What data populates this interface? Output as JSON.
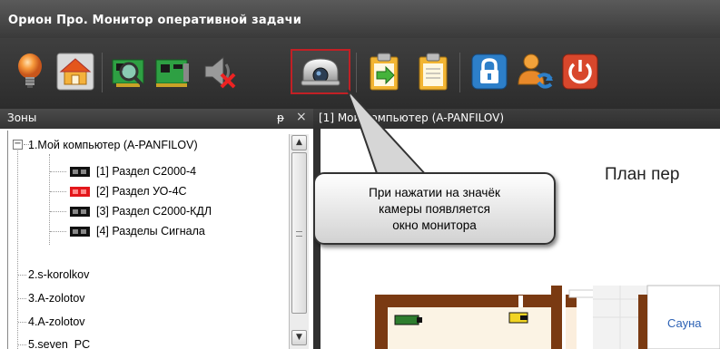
{
  "window": {
    "title": "Орион Про. Монитор оперативной задачи"
  },
  "toolbar": {
    "buttons": [
      {
        "name": "bulb-icon"
      },
      {
        "name": "home-icon"
      },
      {
        "name": "search-board-icon"
      },
      {
        "name": "board-icon"
      },
      {
        "name": "speaker-muted-icon"
      },
      {
        "name": "camera-icon",
        "selected": true
      },
      {
        "name": "clipboard-export-icon"
      },
      {
        "name": "clipboard-icon"
      },
      {
        "name": "lock-icon"
      },
      {
        "name": "user-switch-icon"
      },
      {
        "name": "power-icon"
      }
    ]
  },
  "zones_panel": {
    "title": "Зоны",
    "pin": "ᵽ",
    "close": "×",
    "expander": "−",
    "tree": [
      {
        "label": "1.Мой компьютер (A-PANFILOV)",
        "level": 0
      },
      {
        "label": "[1] Раздел С2000-4",
        "level": 1,
        "icon_color": "#111111"
      },
      {
        "label": "[2] Раздел УО-4С",
        "level": 1,
        "icon_color": "#e3171b"
      },
      {
        "label": "[3] Раздел С2000-КДЛ",
        "level": 1,
        "icon_color": "#111111"
      },
      {
        "label": "[4] Разделы Сигнала",
        "level": 1,
        "icon_color": "#111111"
      },
      {
        "label": "2.s-korolkov",
        "level": 0
      },
      {
        "label": "3.A-zolotov",
        "level": 0
      },
      {
        "label": "4.A-zolotov",
        "level": 0
      },
      {
        "label": "5.seven_PC",
        "level": 0
      }
    ],
    "scroll_up": "▲",
    "scroll_down": "▼"
  },
  "monitor_tab": {
    "title": "[1] Мой компьютер (A-PANFILOV)",
    "plan_title": "План пер",
    "room_label": "Сауна"
  },
  "callout": {
    "lines": [
      "При нажатии на значёк",
      "камеры появляется",
      "окно монитора"
    ]
  },
  "colors": {
    "title_bar": "#4a4a4a",
    "toolbar": "#363636",
    "selection_border": "#c22025",
    "alarm_red": "#e3171b",
    "wall_brown": "#7a3a12"
  }
}
